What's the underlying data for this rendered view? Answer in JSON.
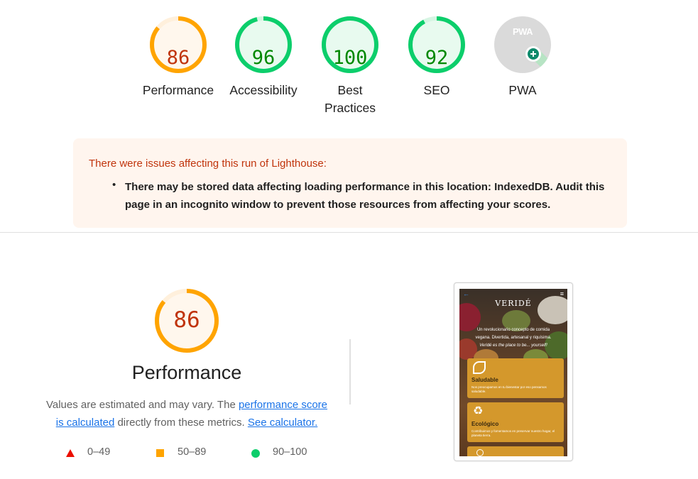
{
  "categories": [
    {
      "score": "86",
      "label_lines": [
        "Performance"
      ],
      "status": "average",
      "color": "#ffa400",
      "text_color": "#c0340c",
      "fill": "#fff7ed",
      "fraction": 0.86
    },
    {
      "score": "96",
      "label_lines": [
        "Accessibility"
      ],
      "status": "pass",
      "color": "#0cce6b",
      "text_color": "#008800",
      "fill": "#e8faef",
      "fraction": 0.96
    },
    {
      "score": "100",
      "label_lines": [
        "Best",
        "Practices"
      ],
      "status": "pass",
      "color": "#0cce6b",
      "text_color": "#008800",
      "fill": "#e8faef",
      "fraction": 1.0
    },
    {
      "score": "92",
      "label_lines": [
        "SEO"
      ],
      "status": "pass",
      "color": "#0cce6b",
      "text_color": "#008800",
      "fill": "#e8faef",
      "fraction": 0.92
    },
    {
      "score": "PWA",
      "label_lines": [
        "PWA"
      ],
      "status": "pwa",
      "color": "#0cce6b",
      "text_color": "#ffffff",
      "fill": "#e0e0e0",
      "fraction": 0
    }
  ],
  "warnings": {
    "title": "There were issues affecting this run of Lighthouse:",
    "items": [
      "There may be stored data affecting loading performance in this location: IndexedDB. Audit this page in an incognito window to prevent those resources from affecting your scores."
    ]
  },
  "performance": {
    "score": "86",
    "fraction": 0.86,
    "title": "Performance",
    "desc_prefix": "Values are estimated and may vary. The ",
    "link_score": "performance score is calculated",
    "desc_middle": " directly from these metrics. ",
    "link_calc": "See calculator."
  },
  "legend": [
    {
      "range": "0–49",
      "shape": "triangle",
      "color": "#eb0f00"
    },
    {
      "range": "50–89",
      "shape": "square",
      "color": "#ffa400"
    },
    {
      "range": "90–100",
      "shape": "circle",
      "color": "#0cce6b"
    }
  ],
  "screenshot": {
    "brand": "VERIDÉ",
    "tagline_lines": [
      "Un revolucionario concepto de comida",
      "vegana. Divertida, artesanal y riquísima.",
      "Veridé es the place to be... yourself!"
    ],
    "cards": [
      {
        "title": "Saludable",
        "text": "Nos preocupamos en tu bienestar por eso pensamos saludable."
      },
      {
        "title": "Ecológico",
        "text": "Contribuimos y fomentamos en preservar nuestro hogar, el planeta tierra."
      }
    ]
  }
}
